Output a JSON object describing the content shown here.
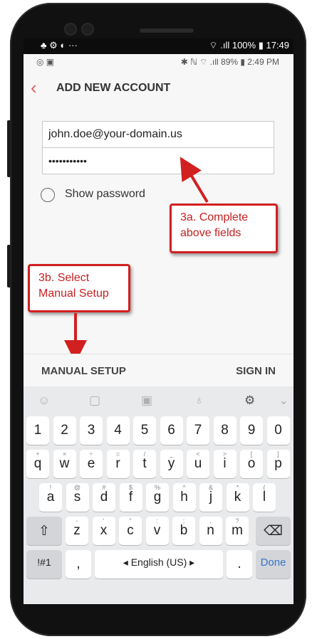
{
  "outer_status": {
    "left_icons": "♣ ⚙ ◐  ···",
    "right": "⌔ .ıll 100% ▮ 17:49"
  },
  "status_bar": {
    "left_icons": "◎ ▣",
    "right": "✱ ℕ ⌔ .ıll 89% ▮ 2:49 PM"
  },
  "header": {
    "title": "ADD NEW ACCOUNT"
  },
  "form": {
    "email_value": "john.doe@your-domain.us",
    "password_value": "•••••••••••",
    "show_password_label": "Show password"
  },
  "callouts": {
    "complete_fields": "3a. Complete above fields",
    "complete_fields_lines": [
      "3a. Complete",
      "above fields"
    ],
    "manual_setup_lines": [
      "3b. Select",
      "Manual Setup"
    ]
  },
  "actions": {
    "manual_setup": "MANUAL SETUP",
    "sign_in": "SIGN IN"
  },
  "keyboard": {
    "number_row": [
      "1",
      "2",
      "3",
      "4",
      "5",
      "6",
      "7",
      "8",
      "9",
      "0"
    ],
    "row1": [
      [
        "+",
        "q"
      ],
      [
        "×",
        "w"
      ],
      [
        "÷",
        "e"
      ],
      [
        "=",
        "r"
      ],
      [
        "/",
        "t"
      ],
      [
        "_",
        "y"
      ],
      [
        "<",
        "u"
      ],
      [
        ">",
        "i"
      ],
      [
        "[",
        "o"
      ],
      [
        "]",
        "p"
      ]
    ],
    "row2": [
      [
        "!",
        "a"
      ],
      [
        "@",
        "s"
      ],
      [
        "#",
        "d"
      ],
      [
        "$",
        "f"
      ],
      [
        "%",
        "g"
      ],
      [
        "^",
        "h"
      ],
      [
        "&",
        "j"
      ],
      [
        "*",
        "k"
      ],
      [
        "(",
        "l"
      ]
    ],
    "row3": [
      [
        "-",
        "z"
      ],
      [
        "'",
        "x"
      ],
      [
        "\"",
        "c"
      ],
      [
        ":",
        "v"
      ],
      [
        ";",
        "b"
      ],
      [
        ",",
        "n"
      ],
      [
        "?",
        "m"
      ]
    ],
    "symbols_label": "!#1",
    "comma": ",",
    "space_label": "◂ English (US) ▸",
    "period": ".",
    "done_label": "Done"
  },
  "colors": {
    "accent": "#e0605e",
    "callout_red": "#d21f1f",
    "done_blue": "#3b73c4"
  }
}
